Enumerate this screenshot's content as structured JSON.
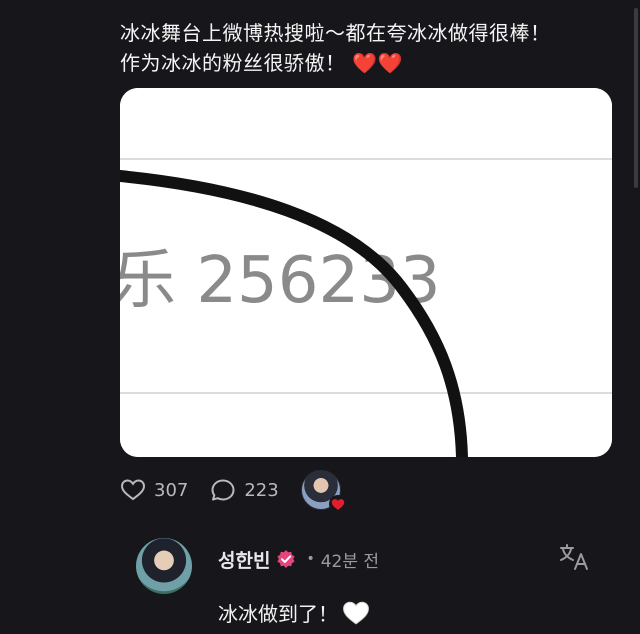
{
  "post": {
    "text_line1": "冰冰舞台上微博热搜啦～都在夸冰冰做得很棒！",
    "text_line2": "作为冰冰的粉丝很骄傲！",
    "text_emoji": "❤️❤️",
    "image": {
      "number_text": "乐 256233",
      "colors": {
        "background": "#ffffff",
        "lines": "#d8d8d8",
        "stroke": "#111111",
        "number": "#8a8a8a"
      }
    },
    "likes": "307",
    "comments": "223",
    "like_icon": "heart-outline-icon",
    "comment_icon": "speech-bubble-icon"
  },
  "reply": {
    "username": "성한빈",
    "time": "42분 전",
    "separator": "•",
    "text": "冰冰做到了！",
    "emoji": "🤍",
    "verified_color": "#e4457a",
    "translate_icon": "translate-icon"
  },
  "theme": {
    "background": "#17171b",
    "text": "#f2f2f2",
    "muted": "#9a9aa0",
    "heart_red": "#e11d2e"
  }
}
